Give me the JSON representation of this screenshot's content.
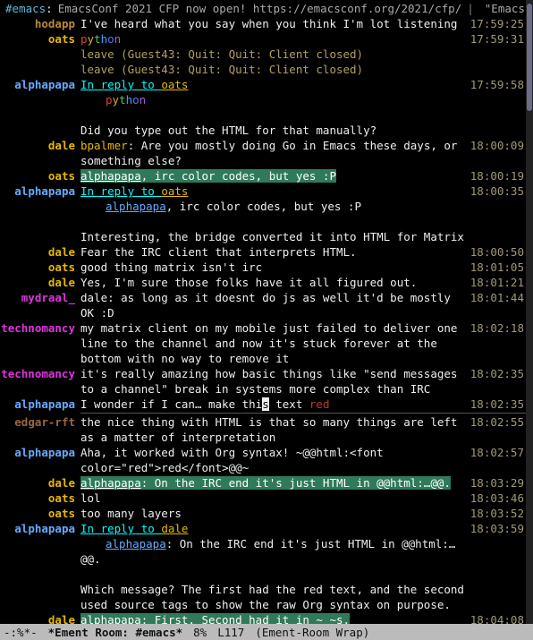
{
  "header": {
    "channel": "#emacs",
    "topic": "EmacsConf 2021 CFP now open! https://emacsconf.org/2021/cfp/",
    "extra": "\"Emacs is a co"
  },
  "modeline": {
    "flags": "-:%*-",
    "buffer": "*Ement Room: #emacs*",
    "pos": "8%",
    "line": "L117",
    "mode": "(Ement-Room Wrap)"
  },
  "nick_colors": {
    "hodapp": "c-hodapp",
    "oats": "c-oats",
    "alphapapa": "c-alphapapa",
    "dale": "c-dale",
    "mydraal_": "c-mydraal",
    "technomancy": "c-technomancy",
    "edgar-rft": "c-edgar"
  },
  "messages": [
    {
      "nick": "hodapp",
      "body": [
        {
          "t": "I've heard what you say when you think I'm lot listening"
        }
      ],
      "ts": "17:59:25"
    },
    {
      "nick": "oats",
      "body": [
        {
          "py": true
        }
      ],
      "ts": "17:59:31"
    },
    {
      "sys": "leave (Guest43: Quit: Quit: Client closed)"
    },
    {
      "sys": "leave (Guest43: Quit: Quit: Client closed)"
    },
    {
      "nick": "alphapapa",
      "body": [
        {
          "t": "In reply to ",
          "cls": "link"
        },
        {
          "t": "oats",
          "cls": "link c-oats"
        }
      ],
      "ts": "17:59:58"
    },
    {
      "nick": "",
      "body": [
        {
          "indent": true
        },
        {
          "py": true
        }
      ]
    },
    {
      "blank": true
    },
    {
      "nick": "",
      "body": [
        {
          "t": "Did you type out the HTML for that manually?"
        }
      ]
    },
    {
      "nick": "dale",
      "body": [
        {
          "t": "bpalmer",
          "cls": "c-bpalmer"
        },
        {
          "t": ": Are you mostly doing Go in Emacs these days, or something else?"
        }
      ],
      "ts": "18:00:09"
    },
    {
      "nick": "oats",
      "body": [
        {
          "t": "alphapapa",
          "cls": "hl"
        },
        {
          "t": ", irc color codes, but yes :P",
          "cls": "hl2"
        }
      ],
      "ts": "18:00:19"
    },
    {
      "nick": "alphapapa",
      "body": [
        {
          "t": "In reply to ",
          "cls": "link"
        },
        {
          "t": "oats",
          "cls": "link c-oats"
        }
      ],
      "ts": "18:00:35"
    },
    {
      "nick": "",
      "body": [
        {
          "indent": true
        },
        {
          "t": "alphapapa",
          "cls": "link c-alphapapa"
        },
        {
          "t": ", irc color codes, but yes :P"
        }
      ]
    },
    {
      "blank": true
    },
    {
      "nick": "",
      "body": [
        {
          "t": "Interesting, the bridge converted it into HTML for Matrix"
        }
      ]
    },
    {
      "nick": "dale",
      "body": [
        {
          "t": "Fear the IRC client that interprets HTML."
        }
      ],
      "ts": "18:00:50"
    },
    {
      "nick": "oats",
      "body": [
        {
          "t": "good thing matrix isn't irc"
        }
      ],
      "ts": "18:01:05"
    },
    {
      "nick": "dale",
      "body": [
        {
          "t": "Yes, I'm sure those folks have it all figured out."
        }
      ],
      "ts": "18:01:21"
    },
    {
      "nick": "mydraal_",
      "body": [
        {
          "t": "dale: as long as it doesnt do js as well it'd be mostly OK :D"
        }
      ],
      "ts": "18:01:44"
    },
    {
      "nick": "technomancy",
      "body": [
        {
          "t": "my matrix client on my mobile just failed to deliver one line to the channel and now it's stuck forever at the bottom with no way to remove it"
        }
      ],
      "ts": "18:02:18"
    },
    {
      "nick": "technomancy",
      "body": [
        {
          "t": "it's really amazing how basic things like \"send messages to a channel\" break in systems more complex than IRC"
        }
      ],
      "ts": "18:02:35"
    },
    {
      "nick": "alphapapa",
      "body": [
        {
          "t": "I wonder if I can… make thi"
        },
        {
          "t": "s",
          "cls": "caret"
        },
        {
          "t": " text "
        },
        {
          "t": "red",
          "cls": "red"
        }
      ],
      "ts": "18:02:35"
    },
    {
      "divider": true
    },
    {
      "nick": "edgar-rft",
      "body": [
        {
          "t": "the nice thing with HTML is that so many things are left as a matter of interpretation"
        }
      ],
      "ts": "18:02:55"
    },
    {
      "nick": "alphapapa",
      "body": [
        {
          "t": "Aha, it worked with Org syntax!  ~@@html:<font color=\"red\">red</font>@@~"
        }
      ],
      "ts": "18:02:57"
    },
    {
      "nick": "dale",
      "body": [
        {
          "t": "alphapapa",
          "cls": "hl"
        },
        {
          "t": ": On the IRC end it's just HTML in @@html:…@@.",
          "cls": "hl2"
        }
      ],
      "ts": "18:03:29"
    },
    {
      "nick": "oats",
      "body": [
        {
          "t": "lol"
        }
      ],
      "ts": "18:03:46"
    },
    {
      "nick": "oats",
      "body": [
        {
          "t": "too many layers"
        }
      ],
      "ts": "18:03:52"
    },
    {
      "nick": "alphapapa",
      "body": [
        {
          "t": "In reply to ",
          "cls": "link"
        },
        {
          "t": "dale",
          "cls": "link c-dale"
        }
      ],
      "ts": "18:03:59"
    },
    {
      "nick": "",
      "body": [
        {
          "indent": true
        },
        {
          "t": "alphapapa",
          "cls": "link c-alphapapa"
        },
        {
          "t": ": On the IRC end it's just HTML in @@html:…@@."
        }
      ]
    },
    {
      "blank": true
    },
    {
      "nick": "",
      "body": [
        {
          "t": "Which message? The first had the red text, and the second used source tags to show the raw Org syntax on purpose."
        }
      ]
    },
    {
      "nick": "dale",
      "body": [
        {
          "t": "alphapapa",
          "cls": "hl"
        },
        {
          "t": ": First. Second had it in ~ ~s.",
          "cls": "hl2"
        }
      ],
      "ts": "18:04:08"
    }
  ]
}
